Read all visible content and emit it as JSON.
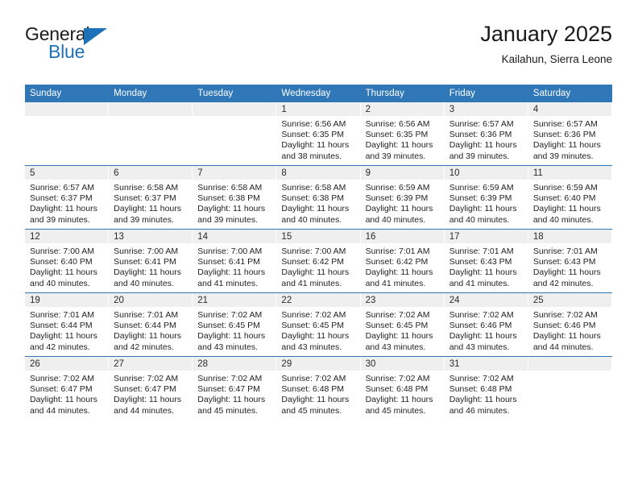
{
  "logo": {
    "word_top": "General",
    "word_bottom": "Blue",
    "triangle_icon": "blue-triangle-icon",
    "brand_color": "#1d71b8"
  },
  "header": {
    "title": "January 2025",
    "subtitle": "Kailahun, Sierra Leone"
  },
  "theme": {
    "header_blue": "#3077b8",
    "daynum_band": "#efefef",
    "text": "#1f1f1f"
  },
  "calendar": {
    "weekday_headers": [
      "Sunday",
      "Monday",
      "Tuesday",
      "Wednesday",
      "Thursday",
      "Friday",
      "Saturday"
    ],
    "weeks": [
      [
        {
          "day": "",
          "empty": true
        },
        {
          "day": "",
          "empty": true
        },
        {
          "day": "",
          "empty": true
        },
        {
          "day": "1",
          "sunrise": "Sunrise: 6:56 AM",
          "sunset": "Sunset: 6:35 PM",
          "daylight": "Daylight: 11 hours and 38 minutes."
        },
        {
          "day": "2",
          "sunrise": "Sunrise: 6:56 AM",
          "sunset": "Sunset: 6:35 PM",
          "daylight": "Daylight: 11 hours and 39 minutes."
        },
        {
          "day": "3",
          "sunrise": "Sunrise: 6:57 AM",
          "sunset": "Sunset: 6:36 PM",
          "daylight": "Daylight: 11 hours and 39 minutes."
        },
        {
          "day": "4",
          "sunrise": "Sunrise: 6:57 AM",
          "sunset": "Sunset: 6:36 PM",
          "daylight": "Daylight: 11 hours and 39 minutes."
        }
      ],
      [
        {
          "day": "5",
          "sunrise": "Sunrise: 6:57 AM",
          "sunset": "Sunset: 6:37 PM",
          "daylight": "Daylight: 11 hours and 39 minutes."
        },
        {
          "day": "6",
          "sunrise": "Sunrise: 6:58 AM",
          "sunset": "Sunset: 6:37 PM",
          "daylight": "Daylight: 11 hours and 39 minutes."
        },
        {
          "day": "7",
          "sunrise": "Sunrise: 6:58 AM",
          "sunset": "Sunset: 6:38 PM",
          "daylight": "Daylight: 11 hours and 39 minutes."
        },
        {
          "day": "8",
          "sunrise": "Sunrise: 6:58 AM",
          "sunset": "Sunset: 6:38 PM",
          "daylight": "Daylight: 11 hours and 40 minutes."
        },
        {
          "day": "9",
          "sunrise": "Sunrise: 6:59 AM",
          "sunset": "Sunset: 6:39 PM",
          "daylight": "Daylight: 11 hours and 40 minutes."
        },
        {
          "day": "10",
          "sunrise": "Sunrise: 6:59 AM",
          "sunset": "Sunset: 6:39 PM",
          "daylight": "Daylight: 11 hours and 40 minutes."
        },
        {
          "day": "11",
          "sunrise": "Sunrise: 6:59 AM",
          "sunset": "Sunset: 6:40 PM",
          "daylight": "Daylight: 11 hours and 40 minutes."
        }
      ],
      [
        {
          "day": "12",
          "sunrise": "Sunrise: 7:00 AM",
          "sunset": "Sunset: 6:40 PM",
          "daylight": "Daylight: 11 hours and 40 minutes."
        },
        {
          "day": "13",
          "sunrise": "Sunrise: 7:00 AM",
          "sunset": "Sunset: 6:41 PM",
          "daylight": "Daylight: 11 hours and 40 minutes."
        },
        {
          "day": "14",
          "sunrise": "Sunrise: 7:00 AM",
          "sunset": "Sunset: 6:41 PM",
          "daylight": "Daylight: 11 hours and 41 minutes."
        },
        {
          "day": "15",
          "sunrise": "Sunrise: 7:00 AM",
          "sunset": "Sunset: 6:42 PM",
          "daylight": "Daylight: 11 hours and 41 minutes."
        },
        {
          "day": "16",
          "sunrise": "Sunrise: 7:01 AM",
          "sunset": "Sunset: 6:42 PM",
          "daylight": "Daylight: 11 hours and 41 minutes."
        },
        {
          "day": "17",
          "sunrise": "Sunrise: 7:01 AM",
          "sunset": "Sunset: 6:43 PM",
          "daylight": "Daylight: 11 hours and 41 minutes."
        },
        {
          "day": "18",
          "sunrise": "Sunrise: 7:01 AM",
          "sunset": "Sunset: 6:43 PM",
          "daylight": "Daylight: 11 hours and 42 minutes."
        }
      ],
      [
        {
          "day": "19",
          "sunrise": "Sunrise: 7:01 AM",
          "sunset": "Sunset: 6:44 PM",
          "daylight": "Daylight: 11 hours and 42 minutes."
        },
        {
          "day": "20",
          "sunrise": "Sunrise: 7:01 AM",
          "sunset": "Sunset: 6:44 PM",
          "daylight": "Daylight: 11 hours and 42 minutes."
        },
        {
          "day": "21",
          "sunrise": "Sunrise: 7:02 AM",
          "sunset": "Sunset: 6:45 PM",
          "daylight": "Daylight: 11 hours and 43 minutes."
        },
        {
          "day": "22",
          "sunrise": "Sunrise: 7:02 AM",
          "sunset": "Sunset: 6:45 PM",
          "daylight": "Daylight: 11 hours and 43 minutes."
        },
        {
          "day": "23",
          "sunrise": "Sunrise: 7:02 AM",
          "sunset": "Sunset: 6:45 PM",
          "daylight": "Daylight: 11 hours and 43 minutes."
        },
        {
          "day": "24",
          "sunrise": "Sunrise: 7:02 AM",
          "sunset": "Sunset: 6:46 PM",
          "daylight": "Daylight: 11 hours and 43 minutes."
        },
        {
          "day": "25",
          "sunrise": "Sunrise: 7:02 AM",
          "sunset": "Sunset: 6:46 PM",
          "daylight": "Daylight: 11 hours and 44 minutes."
        }
      ],
      [
        {
          "day": "26",
          "sunrise": "Sunrise: 7:02 AM",
          "sunset": "Sunset: 6:47 PM",
          "daylight": "Daylight: 11 hours and 44 minutes."
        },
        {
          "day": "27",
          "sunrise": "Sunrise: 7:02 AM",
          "sunset": "Sunset: 6:47 PM",
          "daylight": "Daylight: 11 hours and 44 minutes."
        },
        {
          "day": "28",
          "sunrise": "Sunrise: 7:02 AM",
          "sunset": "Sunset: 6:47 PM",
          "daylight": "Daylight: 11 hours and 45 minutes."
        },
        {
          "day": "29",
          "sunrise": "Sunrise: 7:02 AM",
          "sunset": "Sunset: 6:48 PM",
          "daylight": "Daylight: 11 hours and 45 minutes."
        },
        {
          "day": "30",
          "sunrise": "Sunrise: 7:02 AM",
          "sunset": "Sunset: 6:48 PM",
          "daylight": "Daylight: 11 hours and 45 minutes."
        },
        {
          "day": "31",
          "sunrise": "Sunrise: 7:02 AM",
          "sunset": "Sunset: 6:48 PM",
          "daylight": "Daylight: 11 hours and 46 minutes."
        },
        {
          "day": "",
          "empty": true
        }
      ]
    ]
  }
}
